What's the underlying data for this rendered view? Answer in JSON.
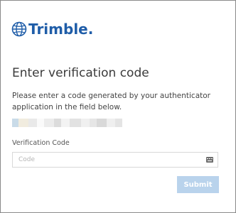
{
  "brand": {
    "name": "Trimble.",
    "icon": "trimble-globe-icon",
    "color": "#1f5da8"
  },
  "page": {
    "title": "Enter verification code",
    "description": "Please enter a code generated by your authenticator application in the field below."
  },
  "form": {
    "label": "Verification Code",
    "placeholder": "Code",
    "value": "",
    "input_icon": "keyboard-icon"
  },
  "actions": {
    "submit_label": "Submit",
    "submit_color": "#b9d3ec"
  }
}
